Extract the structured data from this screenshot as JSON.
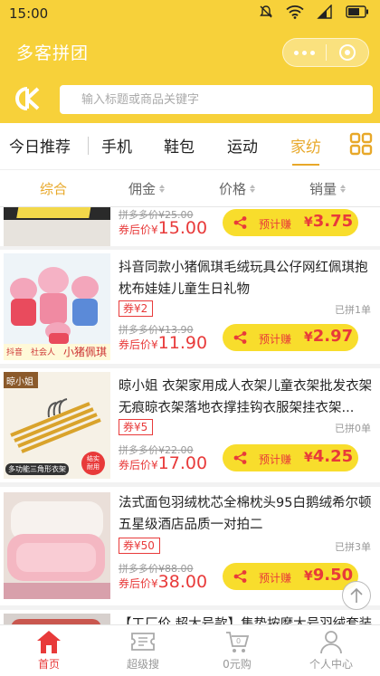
{
  "status_bar": {
    "time": "15:00"
  },
  "app": {
    "title": "多客拼团"
  },
  "search": {
    "placeholder": "输入标题或商品关键字"
  },
  "categories": {
    "items": [
      "今日推荐",
      "手机",
      "鞋包",
      "运动",
      "家纺"
    ],
    "active_index": 4
  },
  "sort": {
    "items": [
      "综合",
      "佣金",
      "价格",
      "销量"
    ],
    "active_index": 0
  },
  "colors": {
    "brand_yellow": "#f7d13a",
    "accent_orange": "#e8a829",
    "price_red": "#e83a3a"
  },
  "products": [
    {
      "name": "",
      "orig_price": "拼多多价¥25.00",
      "after_label": "券后价¥",
      "after_price": "15.00",
      "earn_label": "预计赚",
      "earn_symbol": "¥",
      "earn_amount": "3.75"
    },
    {
      "name": "抖音同款小猪佩琪毛绒玩具公仔网红佩琪抱枕布娃娃儿童生日礼物",
      "coupon": "券¥2",
      "sold": "已拼1单",
      "orig_price": "拼多多价¥13.90",
      "after_label": "券后价¥",
      "after_price": "11.90",
      "earn_label": "预计赚",
      "earn_symbol": "¥",
      "earn_amount": "2.97",
      "thumb_text": [
        "抖音",
        "社会人",
        "小猪佩琪"
      ]
    },
    {
      "name": "晾小姐 衣架家用成人衣架儿童衣架批发衣架无痕晾衣架落地衣撑挂钩衣服架挂衣架...",
      "coupon": "券¥5",
      "sold": "已拼0单",
      "orig_price": "拼多多价¥22.00",
      "after_label": "券后价¥",
      "after_price": "17.00",
      "earn_label": "预计赚",
      "earn_symbol": "¥",
      "earn_amount": "4.25",
      "thumb_text": [
        "晾小姐",
        "多功能三角形衣架",
        "结实",
        "耐用"
      ]
    },
    {
      "name": "法式面包羽绒枕芯全棉枕头95白鹅绒希尔顿五星级酒店品质一对拍二",
      "coupon": "券¥50",
      "sold": "已拼3单",
      "orig_price": "拼多多价¥88.00",
      "after_label": "券后价¥",
      "after_price": "38.00",
      "earn_label": "预计赚",
      "earn_symbol": "¥",
      "earn_amount": "9.50"
    },
    {
      "name": "【工厂价 超大号款】集势按摩大号羽绒套装"
    }
  ],
  "bottom_nav": [
    {
      "label": "首页",
      "icon": "home-icon",
      "active": true
    },
    {
      "label": "超级搜",
      "icon": "ticket-icon",
      "active": false
    },
    {
      "label": "0元购",
      "icon": "cart-icon",
      "active": false
    },
    {
      "label": "个人中心",
      "icon": "person-icon",
      "active": false
    }
  ]
}
